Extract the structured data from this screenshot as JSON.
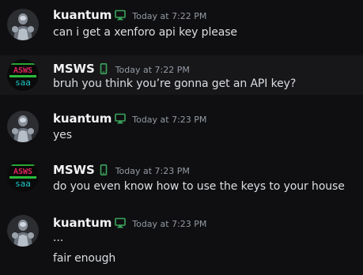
{
  "messages": [
    {
      "author": "kuantum",
      "device": "desktop-icon",
      "timestamp": "Today at 7:22 PM",
      "lines": [
        "can i get a xenforo api key please"
      ],
      "avatar": "robot-avatar",
      "highlighted": false
    },
    {
      "author": "MSWS",
      "device": "mobile-icon",
      "timestamp": "Today at 7:22 PM",
      "lines": [
        "bruh you think you’re gonna get an API key?"
      ],
      "avatar": "msws-avatar",
      "highlighted": true
    },
    {
      "author": "kuantum",
      "device": "desktop-icon",
      "timestamp": "Today at 7:23 PM",
      "lines": [
        "yes"
      ],
      "avatar": "robot-avatar",
      "highlighted": false
    },
    {
      "author": "MSWS",
      "device": "mobile-icon",
      "timestamp": "Today at 7:23 PM",
      "lines": [
        "do you even know how to use the keys to your house"
      ],
      "avatar": "msws-avatar",
      "highlighted": false
    },
    {
      "author": "kuantum",
      "device": "desktop-icon",
      "timestamp": "Today at 7:23 PM",
      "lines": [
        "...",
        "fair enough"
      ],
      "avatar": "robot-avatar",
      "highlighted": false
    }
  ],
  "avatars": {
    "msws_text_top": "ASWS",
    "msws_text_bottom": "saa"
  },
  "colors": {
    "background": "#0f0f11",
    "highlight": "#17171a",
    "username": "#f2f3f5",
    "timestamp": "#949ba4",
    "text": "#dbdee1",
    "device_icon": "#3ba55d",
    "msws_red": "#e0245e",
    "msws_cyan": "#1ec8c8",
    "msws_green": "#2ecc40"
  }
}
